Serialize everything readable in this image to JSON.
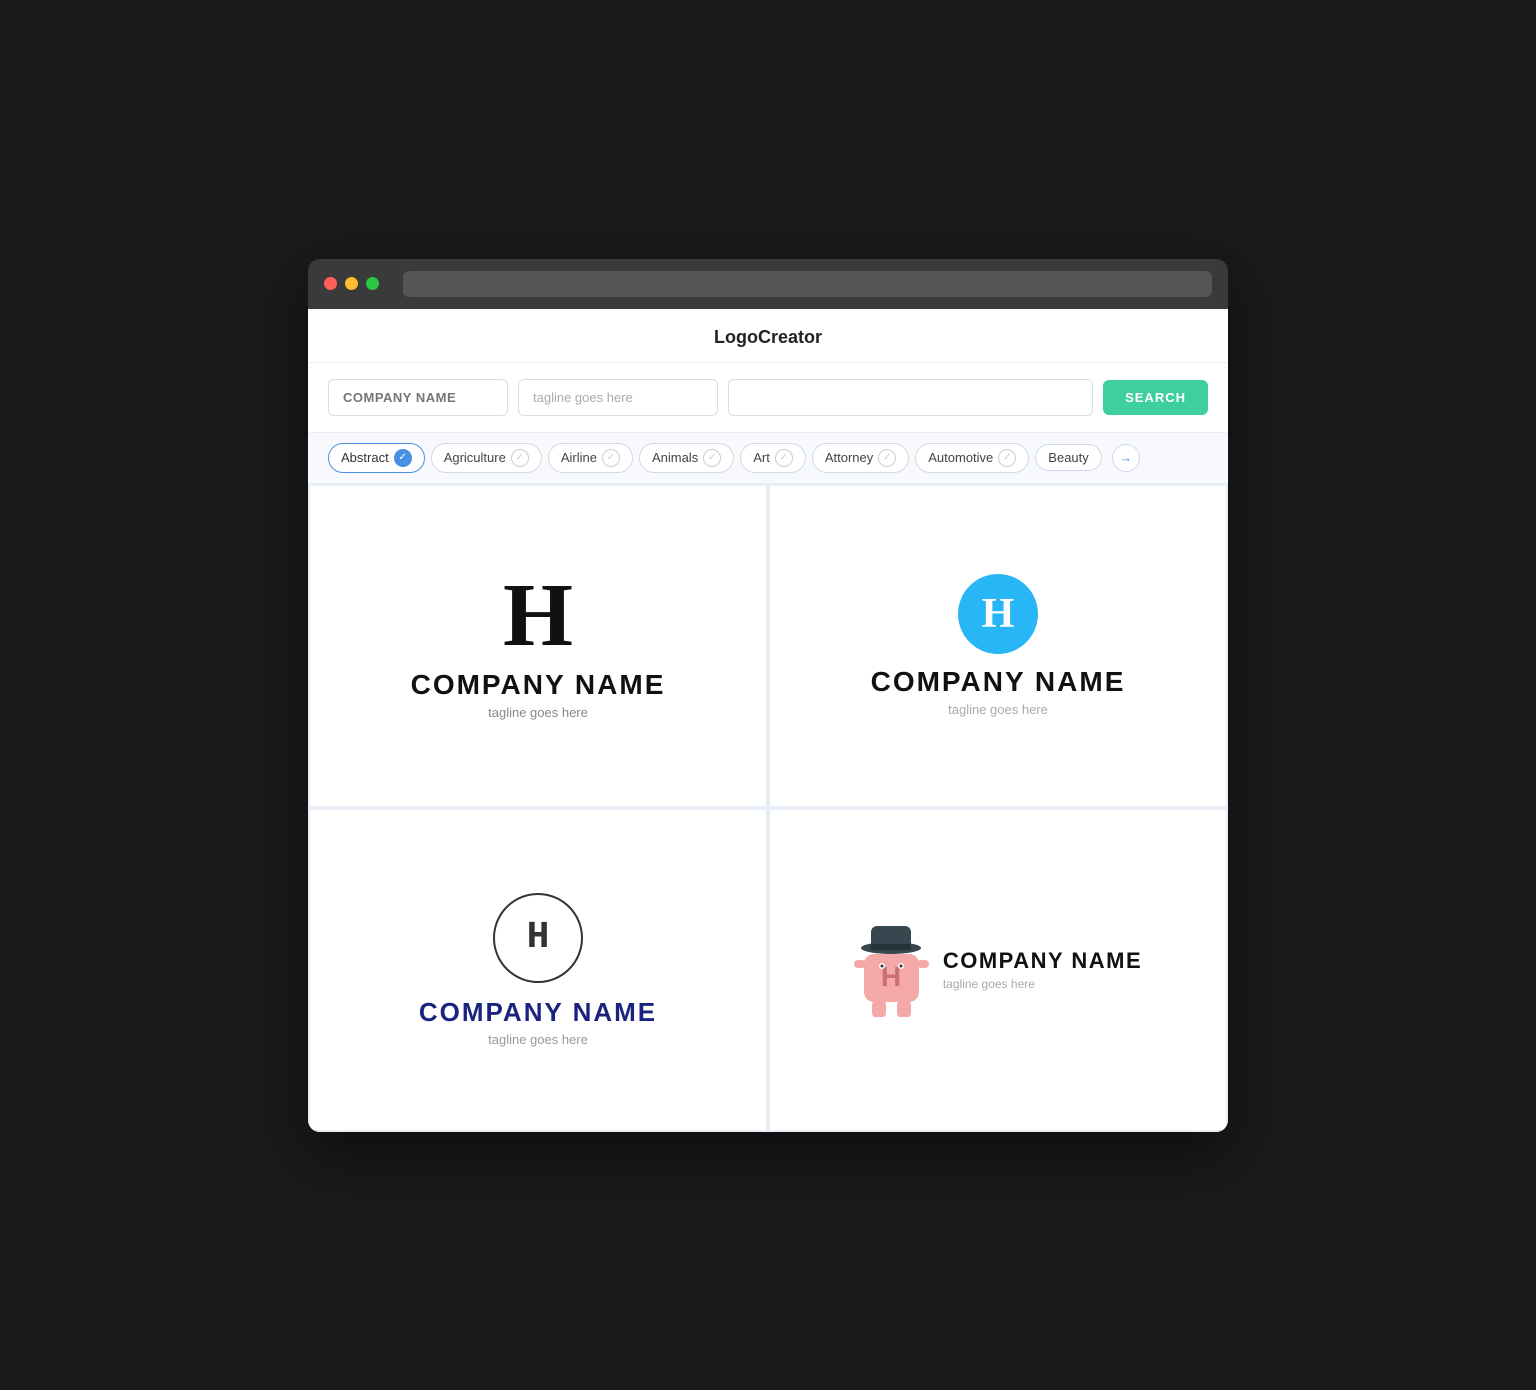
{
  "app": {
    "title": "LogoCreator"
  },
  "searchBar": {
    "companyPlaceholder": "COMPANY NAME",
    "taglinePlaceholder": "tagline goes here",
    "mainPlaceholder": "",
    "searchButtonLabel": "SEARCH"
  },
  "categories": [
    {
      "id": "abstract",
      "label": "Abstract",
      "active": true
    },
    {
      "id": "agriculture",
      "label": "Agriculture",
      "active": false
    },
    {
      "id": "airline",
      "label": "Airline",
      "active": false
    },
    {
      "id": "animals",
      "label": "Animals",
      "active": false
    },
    {
      "id": "art",
      "label": "Art",
      "active": false
    },
    {
      "id": "attorney",
      "label": "Attorney",
      "active": false
    },
    {
      "id": "automotive",
      "label": "Automotive",
      "active": false
    },
    {
      "id": "beauty",
      "label": "Beauty",
      "active": false
    }
  ],
  "logos": [
    {
      "id": "logo1",
      "style": "bold-serif",
      "letter": "H",
      "companyName": "COMPANY NAME",
      "tagline": "tagline goes here"
    },
    {
      "id": "logo2",
      "style": "circle-filled",
      "letter": "H",
      "companyName": "COMPANY NAME",
      "tagline": "tagline goes here"
    },
    {
      "id": "logo3",
      "style": "circle-outline",
      "letter": "H",
      "companyName": "COMPANY NAME",
      "tagline": "tagline goes here"
    },
    {
      "id": "logo4",
      "style": "mascot",
      "letter": "H",
      "companyName": "COMPANY NAME",
      "tagline": "tagline goes here"
    }
  ],
  "colors": {
    "searchButton": "#3ecfa0",
    "activeCategory": "#4a90e2",
    "logo2Circle": "#29b6f6",
    "logo3Text": "#1a237e",
    "mascotBody": "#f4a8a8",
    "mascotHat": "#37474f"
  }
}
